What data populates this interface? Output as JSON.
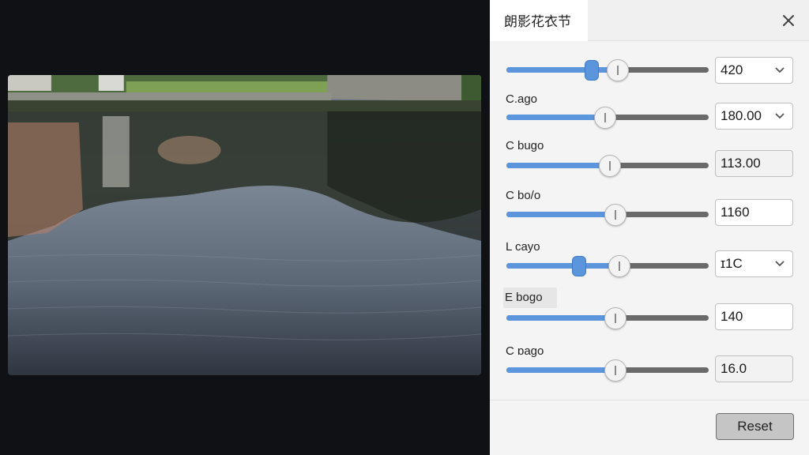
{
  "panel": {
    "title": "朗影花衣节"
  },
  "rows": [
    {
      "label": "",
      "value": "420",
      "fraction": 0.55,
      "marker": 0.42,
      "control": "dropdown"
    },
    {
      "label": "C.ago",
      "value": "180.00",
      "fraction": 0.49,
      "control": "dropdown"
    },
    {
      "label": "C bugo",
      "value": "113.00",
      "fraction": 0.51,
      "control": "readonly"
    },
    {
      "label": "C bo/o",
      "value": "1160",
      "fraction": 0.54,
      "control": "input"
    },
    {
      "label": "L cayo",
      "value": "ɪ1C",
      "fraction": 0.56,
      "marker": 0.36,
      "control": "dropdown"
    },
    {
      "label": "E bogo",
      "value": "140",
      "fraction": 0.54,
      "control": "input"
    },
    {
      "label": "C ɒago",
      "value": "16.0",
      "fraction": 0.54,
      "control": "readonly"
    }
  ],
  "footer": {
    "reset_label": "Reset"
  },
  "icons": {
    "close": "close-icon",
    "chevron": "chevron-down-icon"
  },
  "colors": {
    "accent": "#5b95dc",
    "track": "#6a6a6a"
  }
}
